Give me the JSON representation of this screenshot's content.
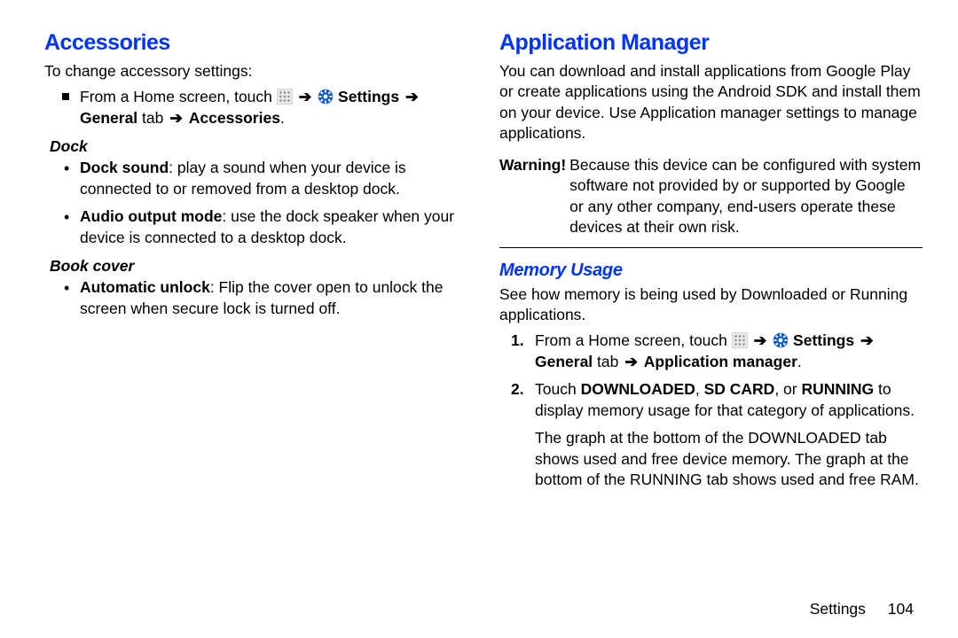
{
  "left": {
    "heading": "Accessories",
    "intro": "To change accessory settings:",
    "nav": {
      "pre": "From a Home screen, touch ",
      "settings": "Settings",
      "general_tab": "General",
      "tab_word": " tab ",
      "dest": "Accessories",
      "period": "."
    },
    "sub1": "Dock",
    "sub1_items": [
      {
        "bold": "Dock sound",
        "rest": ": play a sound when your device is connected to or removed from a desktop dock."
      },
      {
        "bold": "Audio output mode",
        "rest": ": use the dock speaker when your device is connected to a desktop dock."
      }
    ],
    "sub2": "Book cover",
    "sub2_items": [
      {
        "bold": "Automatic unlock",
        "rest": ": Flip the cover open to unlock the screen when secure lock is turned off."
      }
    ]
  },
  "right": {
    "heading": "Application Manager",
    "intro": "You can download and install applications from Google Play or create applications using the Android SDK and install them on your device. Use Application manager settings to manage applications.",
    "warning_label": "Warning!",
    "warning_body": "Because this device can be configured with system software not provided by or supported by Google or any other company, end-users operate these devices at their own risk.",
    "subheading": "Memory Usage",
    "subintro": "See how memory is being used by Downloaded or Running applications.",
    "step1": {
      "pre": "From a Home screen, touch ",
      "settings": "Settings",
      "general_tab": "General",
      "tab_word": " tab ",
      "dest": "Application manager",
      "period": "."
    },
    "step2": {
      "pre": "Touch ",
      "o1": "DOWNLOADED",
      "c1": ", ",
      "o2": "SD CARD",
      "c2": ", or ",
      "o3": "RUNNING",
      "rest": " to display memory usage for that category of applications."
    },
    "step2_more": "The graph at the bottom of the DOWNLOADED tab shows used and free device memory. The graph at the bottom of the RUNNING tab shows used and free RAM."
  },
  "footer": {
    "section": "Settings",
    "page": "104"
  },
  "arrow": "➔"
}
